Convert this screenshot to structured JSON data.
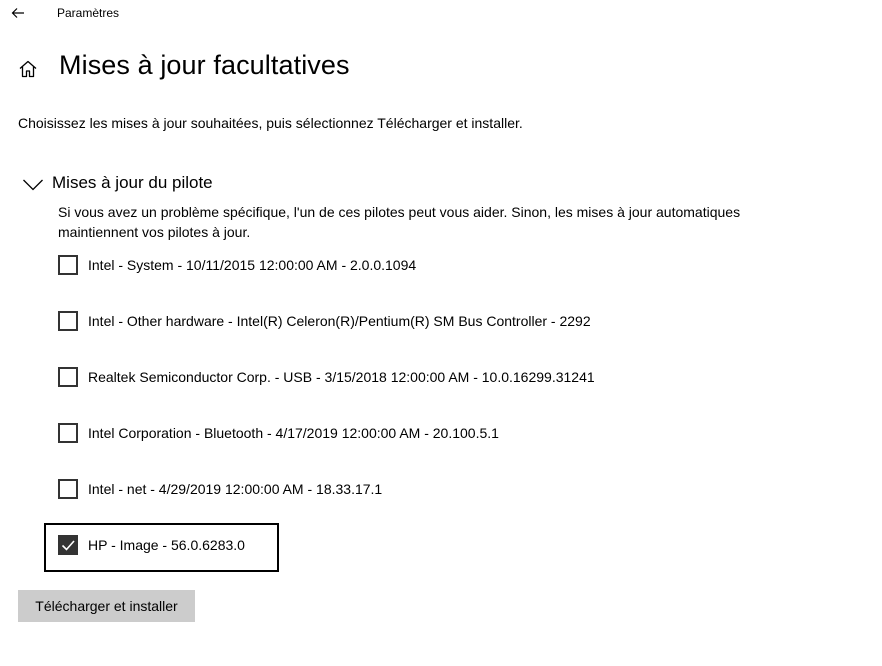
{
  "window": {
    "title": "Paramètres"
  },
  "header": {
    "title": "Mises à jour facultatives"
  },
  "instructions": "Choisissez les mises à jour souhaitées, puis sélectionnez Télécharger et installer.",
  "section": {
    "title": "Mises à jour du pilote",
    "expanded": true,
    "description": "Si vous avez un problème spécifique, l'un de ces pilotes peut vous aider. Sinon, les mises à jour automatiques maintiennent vos pilotes à jour."
  },
  "drivers": [
    {
      "label": "Intel - System - 10/11/2015 12:00:00 AM - 2.0.0.1094",
      "checked": false
    },
    {
      "label": "Intel - Other hardware - Intel(R) Celeron(R)/Pentium(R) SM Bus Controller - 2292",
      "checked": false
    },
    {
      "label": "Realtek Semiconductor Corp. - USB - 3/15/2018 12:00:00 AM - 10.0.16299.31241",
      "checked": false
    },
    {
      "label": "Intel Corporation - Bluetooth - 4/17/2019 12:00:00 AM - 20.100.5.1",
      "checked": false
    },
    {
      "label": "Intel - net - 4/29/2019 12:00:00 AM - 18.33.17.1",
      "checked": false
    },
    {
      "label": "HP - Image - 56.0.6283.0",
      "checked": true
    }
  ],
  "actions": {
    "install_label": "Télécharger et installer"
  },
  "icons": {
    "back": "back-arrow-icon",
    "home": "home-icon",
    "section_toggle": "chevron-down-icon",
    "check": "checkmark-icon"
  },
  "colors": {
    "checkbox_border": "#333333",
    "checked_fill": "#333333",
    "button_bg": "#cccccc",
    "highlight_border": "#000000"
  }
}
